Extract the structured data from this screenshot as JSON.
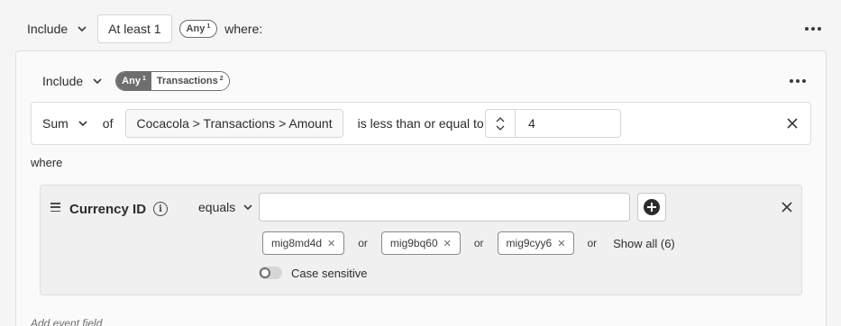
{
  "top": {
    "include_label": "Include",
    "at_least_label": "At least 1",
    "any_pill": "Any",
    "any_sup": "1",
    "where_label": "where:"
  },
  "group": {
    "include_label": "Include",
    "seg_any": "Any",
    "seg_any_sup": "1",
    "seg_transactions": "Transactions",
    "seg_transactions_sup": "2"
  },
  "condition": {
    "aggregate": "Sum",
    "of_label": "of",
    "field_path": "Cocacola > Transactions > Amount",
    "operator": "is less than or equal to",
    "value": "4"
  },
  "where_label": "where",
  "event_field": {
    "name": "Currency ID",
    "operator": "equals",
    "input_value": "",
    "tags": [
      "mig8md4d",
      "mig9bq60",
      "mig9cyy6"
    ],
    "or_label": "or",
    "show_all": "Show all (6)",
    "case_sensitive_label": "Case sensitive"
  },
  "add_event_field": "Add event field"
}
